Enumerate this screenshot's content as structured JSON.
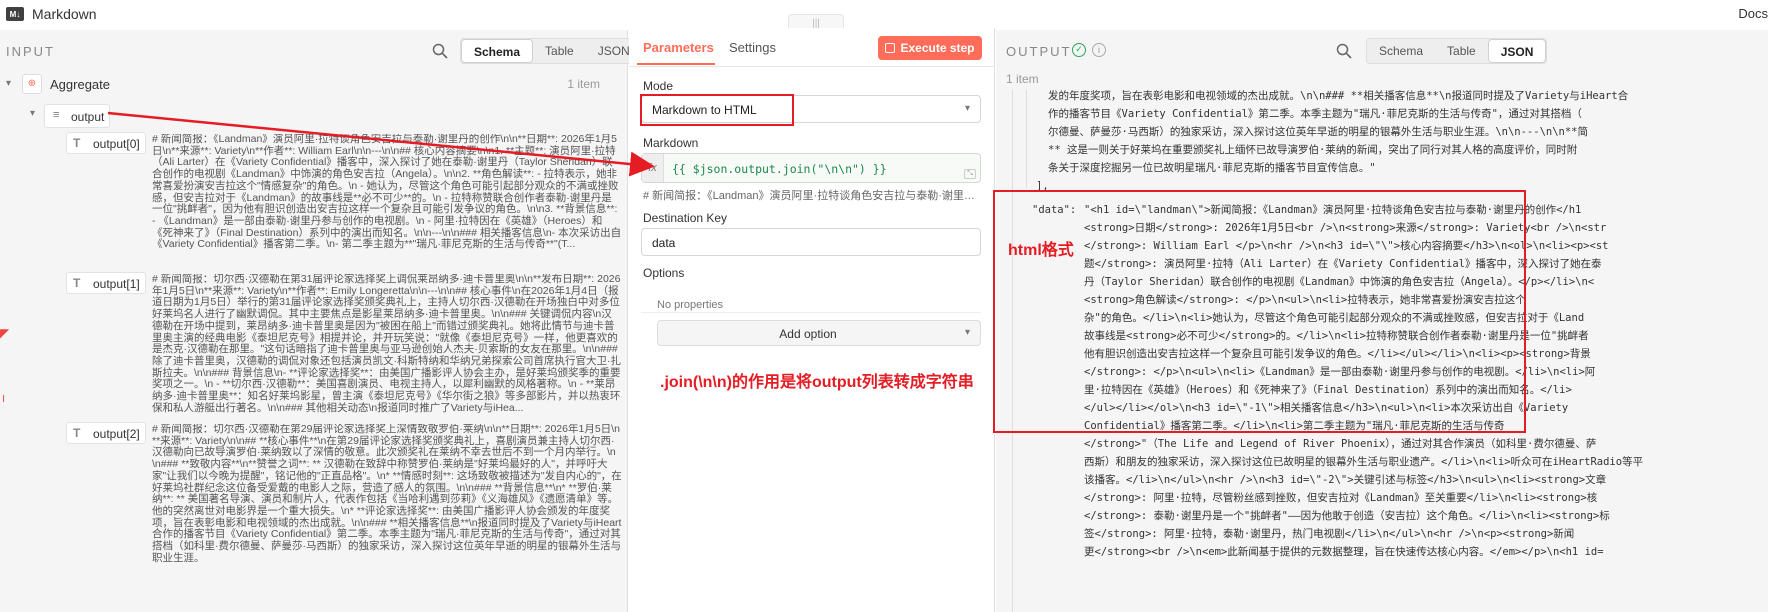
{
  "app": {
    "icon_text": "M↓",
    "title": "Markdown",
    "docs_label": "Docs"
  },
  "drag_handle": "|||",
  "input_panel": {
    "title": "INPUT",
    "view_tabs": [
      "Schema",
      "Table",
      "JSON"
    ],
    "active_view": "Schema",
    "aggregate": {
      "label": "Aggregate",
      "count": "1 item"
    },
    "output_node": {
      "label": "output"
    },
    "items": [
      {
        "label": "output[0]",
        "text": "# 新闻简报：《Landman》演员阿里·拉特谈角色安吉拉与泰勒·谢里丹的创作\\n\\n**日期**: 2026年1月5日\\n**来源**: Variety\\n**作者**: William Earl\\n\\n---\\n\\n## 核心内容摘要\\n\\n1. **主题**: 演员阿里·拉特（Ali Larter）在《Variety Confidential》播客中，深入探讨了她在泰勒·谢里丹（Taylor Sheridan）联合创作的电视剧《Landman》中饰演的角色安吉拉（Angela）。\\n\\n2. **角色解读**: - 拉特表示，她非常喜爱扮演安吉拉这个\"情感复杂\"的角色。\\n - 她认为，尽管这个角色可能引起部分观众的不满或挫败感，但安吉拉对于《Landman》的故事线是**必不可少**的。\\n - 拉特称赞联合创作者泰勒·谢里丹是一位\"挑衅者\"，因为他有胆识创造出安吉拉这样一个复杂且可能引发争议的角色。\\n\\n3. **背景信息**: - 《Landman》是一部由泰勒·谢里丹参与创作的电视剧。\\n - 阿里·拉特因在《英雄》（Heroes）和《死神来了》（Final Destination）系列中的演出而知名。\\n\\n---\\n\\n### 相关播客信息\\n- 本次采访出自《Variety Confidential》播客第二季。\\n- 第二季主题为**\"瑞凡·菲尼克斯的生活与传奇**\"(T..."
      },
      {
        "label": "output[1]",
        "text": "# 新闻简报：切尔西·汉德勒在第31届评论家选择奖上调侃莱昂纳多·迪卡普里奥\\n\\n**发布日期**: 2026年1月5日\\n**来源**: Variety\\n**作者**: Emily Longeretta\\n\\n---\\n\\n## 核心事件\\n在2026年1月4日（报道日期为1月5日）举行的第31届评论家选择奖颁奖典礼上，主持人切尔西·汉德勒在开场独白中对多位好莱坞名人进行了幽默调侃。其中主要焦点是影星莱昂纳多·迪卡普里奥。\\n\\n### 关键调侃内容\\n汉德勒在开场中提到，莱昂纳多·迪卡普里奥是因为\"被困在船上\"而错过颁奖典礼。她将此情节与迪卡普里奥主演的经典电影《泰坦尼克号》相提并论，并开玩笑说：\"就像《泰坦尼克号》一样，他更喜欢的是杰克·汉德勒在那里。\"这句话暗指了迪卡普里奥与亚马逊创始人杰夫·贝索斯的女友在那里。\\n\\n### 除了迪卡普里奥，汉德勒的调侃对象还包括演员凯文·科斯特纳和华纳兄弟探索公司首席执行官大卫·扎斯拉夫。\\n\\n### 背景信息\\n- **评论家选择奖**：由美国广播影评人协会主办，是好莱坞颁奖季的重要奖项之一。\\n - **切尔西·汉德勒**：美国喜剧演员、电视主持人，以犀利幽默的风格著称。\\n - **莱昂纳多·迪卡普里奥**：知名好莱坞影星，曾主演《泰坦尼克号》《华尔街之狼》等多部影片，并以热衷环保和私人游艇出行著名。\\n\\n### 其他相关动态\\n报道同时推广了Variety与iHea..."
      },
      {
        "label": "output[2]",
        "text": "# 新闻简报：切尔西·汉德勒在第29届评论家选择奖上深情致敬罗伯·莱纳\\n\\n**日期**: 2026年1月5日\\n**来源**: Variety\\n\\n## **核心事件**\\n在第29届评论家选择奖颁奖典礼上，喜剧演员兼主持人切尔西·汉德勒向已故导演罗伯·莱纳致以了深情的敬意。此次颁奖礼在莱纳不幸去世后不到一个月内举行。\\n\\n### **致敬内容**\\n**赞誉之词**: ** 汉德勒在致辞中称赞罗伯·莱纳是\"好莱坞最好的人\"，并呼吁大家\"让我们以今晚为提醒\"，铭记他的\"正直品格\"。\\n* **情感时刻**: 这场致敬被描述为\"发自内心的\"，在好莱坞社群纪念这位备受爱戴的电影人之际，营造了感人的氛围。\\n\\n### **背景信息**\\n* **罗伯·莱纳**: ** 美国著名导演、演员和制片人，代表作包括《当哈利遇到莎莉》《义海雄风》《遗愿清单》等。他的突然离世对电影界是一个重大损失。\\n* **评论家选择奖**: 由美国广播影评人协会颁发的年度奖项，旨在表彰电影和电视领域的杰出成就。\\n\\n### **相关播客信息**\\n报道同时提及了Variety与iHeart合作的播客节目《Variety Confidential》第二季。本季主题为\"瑞凡·菲尼克斯的生活与传奇\"，通过对其搭档（如科里·费尔德曼、萨曼莎·马西斯）的独家采访，深入探讨这位英年早逝的明星的银幕外生活与职业生涯。"
      }
    ]
  },
  "parameters_panel": {
    "tabs": [
      "Parameters",
      "Settings"
    ],
    "active_tab": "Parameters",
    "execute_label": "Execute step",
    "mode_label": "Mode",
    "mode_value": "Markdown to HTML",
    "markdown_label": "Markdown",
    "fx_label": "fx",
    "markdown_expression": "{{ $json.output.join(\"\\n\\n\") }}",
    "markdown_preview": "# 新闻简报：《Landman》演员阿里·拉特谈角色安吉拉与泰勒·谢里丹...",
    "destination_key_label": "Destination Key",
    "destination_key_value": "data",
    "options_label": "Options",
    "no_properties": "No properties",
    "add_option_label": "Add option"
  },
  "output_panel": {
    "title": "OUTPUT",
    "view_tabs": [
      "Schema",
      "Table",
      "JSON"
    ],
    "active_view": "JSON",
    "count": "1 item",
    "lines_before": [
      "发的年度奖项，旨在表彰电影和电视领域的杰出成就。\\n\\n### **相关播客信息**\\n报道同时提及了Variety与iHeart合",
      "作的播客节目《Variety Confidential》第二季。本季主题为\"瑞凡·菲尼克斯的生活与传奇\"，通过对其搭档（",
      "尔德曼、萨曼莎·马西斯）的独家采访，深入探讨这位英年早逝的明星的银幕外生活与职业生涯。\\n\\n---\\n\\n**简",
      "** 这是一则关于好莱坞在重要颁奖礼上缅怀已故导演罗伯·莱纳的新闻，突出了同行对其人格的高度评价，同时附",
      "条关于深度挖掘另一位已故明星瑞凡·菲尼克斯的播客节目宣传信息。\""
    ],
    "close_bracket": "],",
    "data_key": "\"data\":",
    "data_lines": [
      "\"<h1 id=\\\"landman\\\">新闻简报：《Landman》演员阿里·拉特谈角色安吉拉与泰勒·谢里丹的创作</h1",
      "<strong>日期</strong>: 2026年1月5日<br />\\n<strong>来源</strong>: Variety<br />\\n<str",
      "</strong>: William Earl  </p>\\n<hr />\\n<h3 id=\\\"\\\">核心内容摘要</h3>\\n<ol>\\n<li><p><st",
      "题</strong>: 演员阿里·拉特（Ali Larter）在《Variety Confidential》播客中，深入探讨了她在泰",
      "丹（Taylor Sheridan）联合创作的电视剧《Landman》中饰演的角色安吉拉（Angela）。</p></li>\\n<",
      "<strong>角色解读</strong>: </p>\\n<ul>\\n<li>拉特表示，她非常喜爱扮演安吉拉这个",
      "杂\"的角色。</li>\\n<li>她认为，尽管这个角色可能引起部分观众的不满或挫败感，但安吉拉对于《Land",
      "故事线是<strong>必不可少</strong>的。</li>\\n<li>拉特称赞联合创作者泰勒·谢里丹是一位\"挑衅者",
      "他有胆识创造出安吉拉这样一个复杂且可能引发争议的角色。</li></ul></li>\\n<li><p><strong>背景",
      "</strong>: </p>\\n<ul>\\n<li>《Landman》是一部由泰勒·谢里丹参与创作的电视剧。</li>\\n<li>阿",
      "里·拉特因在《英雄》（Heroes）和《死神来了》（Final Destination）系列中的演出而知名。</li>",
      "</ul></li></ol>\\n<h3 id=\\\"-1\\\">相关播客信息</h3>\\n<ul>\\n<li>本次采访出自《Variety",
      "Confidential》播客第二季。</li>\\n<li>第二季主题为\"瑞凡·菲尼克斯的生活与传奇",
      "</strong>\"（The Life and Legend of River Phoenix），通过对其合作演员（如科里·费尔德曼、萨",
      "西斯）和朋友的独家采访，深入探讨这位已故明星的银幕外生活与职业遗产。</li>\\n<li>听众可在iHeartRadio等平",
      "该播客。</li>\\n</ul>\\n<hr />\\n<h3 id=\\\"-2\\\">关键引述与标签</h3>\\n<ul>\\n<li><strong>文章",
      "</strong>: 阿里·拉特，尽管粉丝感到挫败，但安吉拉对《Landman》至关重要</li>\\n<li><strong>核",
      "</strong>: 泰勒·谢里丹是一个\"挑衅者\"——因为他敢于创造（安吉拉）这个角色。</li>\\n<li><strong>标",
      "签</strong>: 阿里·拉特，泰勒·谢里丹，热门电视剧</li>\\n</ul>\\n<hr />\\n<p><strong>新闻",
      "更</strong><br />\\n<em>此新闻基于提供的元数据整理，旨在快速传达核心内容。</em></p>\\n<h1 id="
    ]
  },
  "annotations": {
    "html_label": "html格式",
    "join_note": ".join(\\n\\n)的作用是将output列表转成字符串"
  },
  "colors": {
    "accent": "#ff6d5a",
    "annotation": "#e51c23",
    "success": "#2aa55a"
  }
}
